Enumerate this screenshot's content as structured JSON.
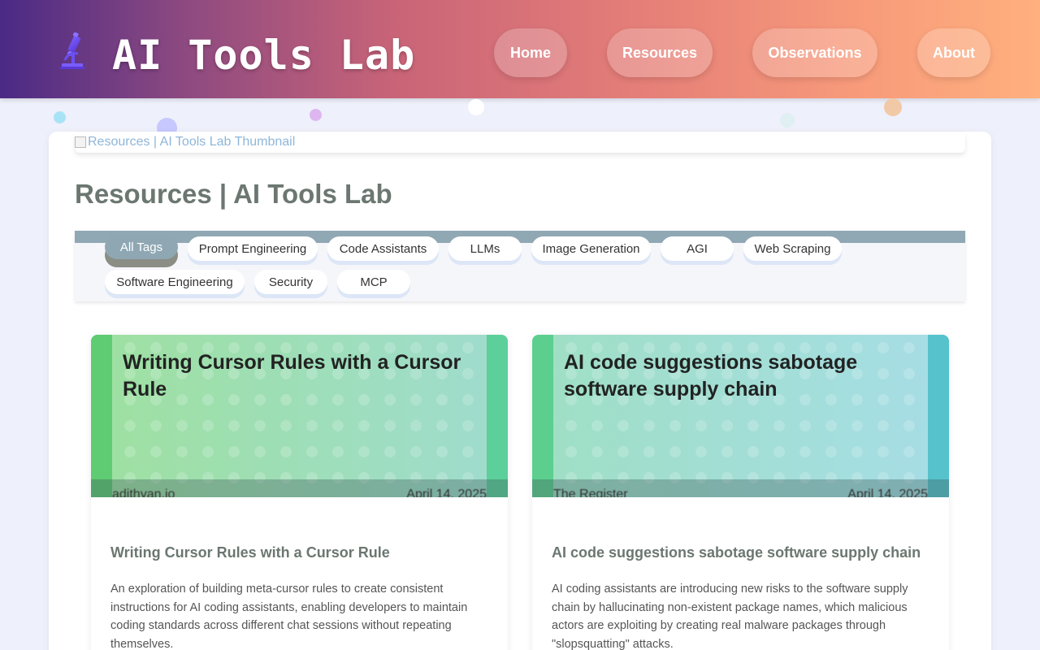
{
  "header": {
    "logo_icon": "microscope-icon",
    "site_title": "AI Tools Lab",
    "nav": [
      {
        "label": "Home"
      },
      {
        "label": "Resources"
      },
      {
        "label": "Observations"
      },
      {
        "label": "About"
      }
    ]
  },
  "thumbnail": {
    "alt": "Resources | AI Tools Lab Thumbnail"
  },
  "page": {
    "title": "Resources | AI Tools Lab"
  },
  "tags": {
    "active": "All Tags",
    "items": [
      "All Tags",
      "Prompt Engineering",
      "Code Assistants",
      "LLMs",
      "Image Generation",
      "AGI",
      "Web Scraping",
      "Software Engineering",
      "Security",
      "MCP"
    ]
  },
  "articles": [
    {
      "image_title": "Writing Cursor Rules with a Cursor Rule",
      "image_source": "adithyan.io",
      "image_date": "April 14, 2025",
      "title": "Writing Cursor Rules with a Cursor Rule",
      "description": "An exploration of building meta-cursor rules to create consistent instructions for AI coding assistants, enabling developers to maintain coding standards across different chat sessions without repeating themselves."
    },
    {
      "image_title": "AI code suggestions sabotage software supply chain",
      "image_source": "The Register",
      "image_date": "April 14, 2025",
      "title": "AI code suggestions sabotage software supply chain",
      "description": "AI coding assistants are introducing new risks to the software supply chain by hallucinating non-existent package names, which malicious actors are exploiting by creating real malware packages through \"slopsquatting\" attacks."
    }
  ],
  "colors": {
    "header_gradient_start": "#4a2a85",
    "header_gradient_end": "#ffb07e",
    "active_tag": "#8ea7b3",
    "title_text": "#6b7770",
    "card1_gradient_start": "#9ee0a0",
    "card1_gradient_end": "#9fdccf",
    "card2_gradient_start": "#9fdfc4",
    "card2_gradient_end": "#a6dde6"
  }
}
